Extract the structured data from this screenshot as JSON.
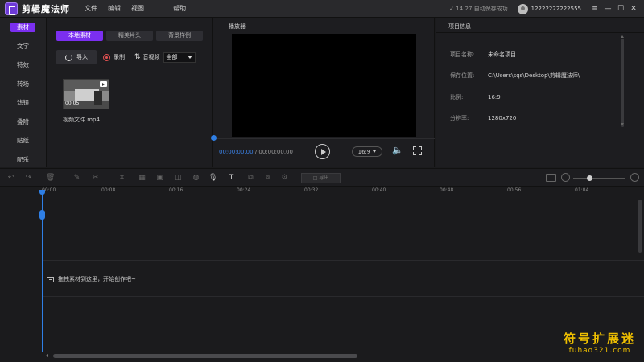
{
  "titlebar": {
    "app_title": "剪辑魔法师",
    "menu": [
      "文件",
      "编辑",
      "视图",
      "帮助"
    ],
    "autosave": "✓ 14:27 自动保存成功",
    "user": "12222222222555",
    "win_buttons": [
      "≡",
      "—",
      "☐",
      "✕"
    ]
  },
  "leftnav": {
    "items": [
      "素材",
      "文字",
      "特效",
      "转场",
      "滤镜",
      "叠附",
      "贴纸",
      "配乐"
    ],
    "active_index": 0
  },
  "material": {
    "subtabs": [
      "本地素材",
      "精美片头",
      "背景样例"
    ],
    "import_label": "导入",
    "record_label": "录制",
    "audio_label": "音视频",
    "filter_value": "全部",
    "thumb_duration": "00:05",
    "file_name": "视频文件.mp4"
  },
  "player": {
    "title": "播放器",
    "current_time": "00:00:00.00",
    "separator": " / ",
    "total_time": "00:00:00.00",
    "ratio": "16:9"
  },
  "info": {
    "title": "项目信息",
    "rows": [
      {
        "k": "项目名称:",
        "v": "未命名项目"
      },
      {
        "k": "保存位置:",
        "v": "C:\\Users\\sqs\\Desktop\\剪辑魔法师\\"
      },
      {
        "k": "比例:",
        "v": "16:9"
      },
      {
        "k": "分辨率:",
        "v": "1280x720"
      }
    ]
  },
  "timeline": {
    "export_label": "□ 导出",
    "ticks": [
      "00:00",
      "00:08",
      "00:16",
      "00:24",
      "00:32",
      "00:40",
      "00:48",
      "00:56",
      "01:04"
    ],
    "drop_hint": "拖拽素材到这里，开始创作吧~"
  },
  "watermark": {
    "cn": "符号扩展迷",
    "en": "fuhao321.com"
  },
  "colors": {
    "accent": "#7b2ff0",
    "playhead": "#2f7fe5",
    "record": "#e25151"
  }
}
